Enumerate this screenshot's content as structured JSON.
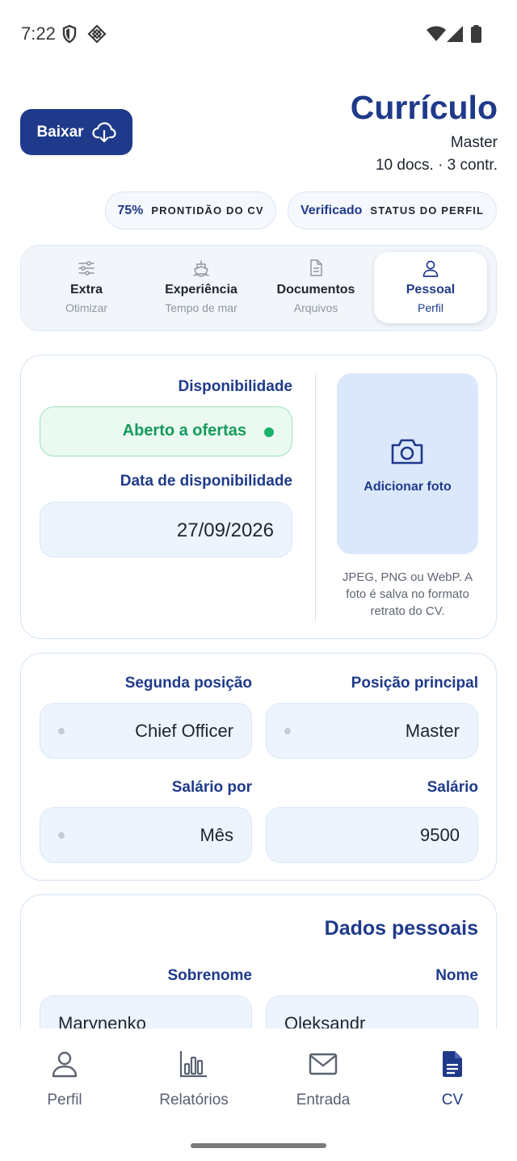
{
  "status_bar": {
    "time": "7:22"
  },
  "header": {
    "download_label": "Baixar",
    "title": "Currículo",
    "rank": "Master",
    "summary": "10 docs. · 3 contr."
  },
  "pills": [
    {
      "value": "75%",
      "label": "PRONTIDÃO DO CV"
    },
    {
      "value": "Verificado",
      "label": "STATUS DO PERFIL"
    }
  ],
  "tabs": [
    {
      "label": "Extra",
      "sub": "Otimizar",
      "icon": "sliders-icon"
    },
    {
      "label": "Experiência",
      "sub": "Tempo de mar",
      "icon": "ship-icon"
    },
    {
      "label": "Documentos",
      "sub": "Arquivos",
      "icon": "document-icon"
    },
    {
      "label": "Pessoal",
      "sub": "Perfil",
      "icon": "person-icon",
      "active": true
    }
  ],
  "availability": {
    "label": "Disponibilidade",
    "value": "Aberto a ofertas",
    "date_label": "Data de disponibilidade",
    "date_value": "27/09/2026"
  },
  "photo": {
    "button_label": "Adicionar foto",
    "hint": "JPEG, PNG ou WebP. A foto é salva no formato retrato do CV."
  },
  "positions": {
    "secondary_label": "Segunda posição",
    "secondary_value": "Chief Officer",
    "primary_label": "Posição principal",
    "primary_value": "Master",
    "salary_period_label": "Salário por",
    "salary_period_value": "Mês",
    "salary_label": "Salário",
    "salary_value": "9500"
  },
  "personal": {
    "title": "Dados pessoais",
    "surname_label": "Sobrenome",
    "surname_value": "Marynenko",
    "name_label": "Nome",
    "name_value": "Oleksandr"
  },
  "bottom_nav": [
    {
      "label": "Perfil",
      "icon": "person-icon"
    },
    {
      "label": "Relatórios",
      "icon": "bar-chart-icon"
    },
    {
      "label": "Entrada",
      "icon": "mail-icon"
    },
    {
      "label": "CV",
      "icon": "document-filled-icon",
      "active": true
    }
  ],
  "colors": {
    "primary": "#1f3a8a",
    "available_green": "#1cb26b",
    "field_bg": "#edf4fd"
  }
}
